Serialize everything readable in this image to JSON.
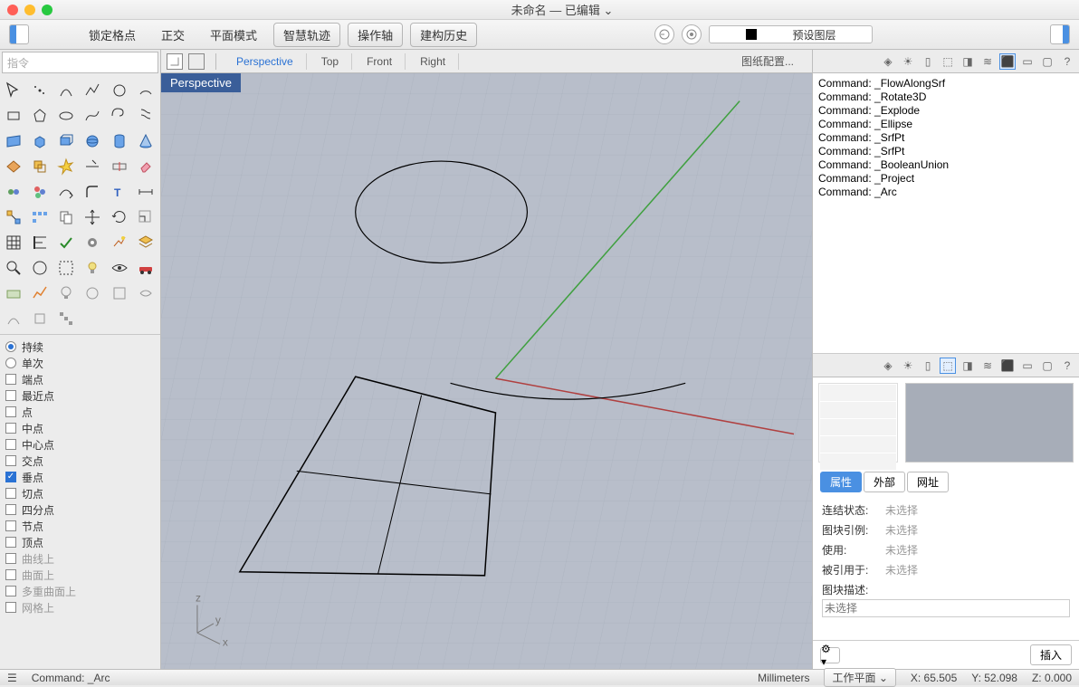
{
  "title": "未命名 — 已编辑 ⌄",
  "toolbar": {
    "lock": "锁定格点",
    "ortho": "正交",
    "planar": "平面模式",
    "smart": "智慧轨迹",
    "gumball": "操作轴",
    "history": "建构历史",
    "layer_label": "预设图层"
  },
  "cmd_placeholder": "指令",
  "viewtabs": {
    "v1": "Perspective",
    "v2": "Top",
    "v3": "Front",
    "v4": "Right",
    "config": "图纸配置..."
  },
  "viewport_label": "Perspective",
  "osnap": {
    "persist": "持续",
    "single": "单次",
    "end": "端点",
    "near": "最近点",
    "point": "点",
    "mid": "中点",
    "center": "中心点",
    "int": "交点",
    "perp": "垂点",
    "tan": "切点",
    "quad": "四分点",
    "knot": "节点",
    "vertex": "顶点",
    "oncurve": "曲线上",
    "onsurf": "曲面上",
    "onpolysrf": "多重曲面上",
    "onmesh": "网格上"
  },
  "history": [
    "Command: _FlowAlongSrf",
    "Command: _Rotate3D",
    "Command: _Explode",
    "Command: _Ellipse",
    "Command: _SrfPt",
    "Command: _SrfPt",
    "Command: _BooleanUnion",
    "Command: _Project",
    "Command: _Arc"
  ],
  "proptabs": {
    "attr": "属性",
    "ext": "外部",
    "url": "网址"
  },
  "props": {
    "link": "连结状态:",
    "link_v": "未选择",
    "inst": "图块引例:",
    "inst_v": "未选择",
    "use": "使用:",
    "use_v": "未选择",
    "ref": "被引用于:",
    "ref_v": "未选择",
    "desc": "图块描述:",
    "desc_ph": "未选择"
  },
  "insert_btn": "插入",
  "status": {
    "cmd": "Command: _Arc",
    "units": "Millimeters",
    "plane": "工作平面 ⌄",
    "x": "X: 65.505",
    "y": "Y: 52.098",
    "z": "Z: 0.000"
  }
}
